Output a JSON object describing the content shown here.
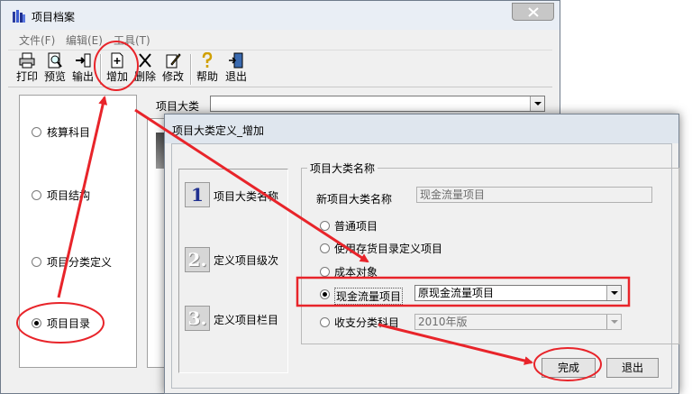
{
  "main_window": {
    "title": "项目档案",
    "menu": [
      "文件(F)",
      "编辑(E)",
      "工具(T)"
    ],
    "toolbar": {
      "print": "打印",
      "preview": "预览",
      "export": "输出",
      "add": "增加",
      "delete": "删除",
      "modify": "修改",
      "help": "帮助",
      "exit": "退出"
    },
    "left_options": [
      "核算科目",
      "项目结构",
      "项目分类定义",
      "项目目录"
    ],
    "selected_option": "项目目录",
    "category_label": "项目大类",
    "category_value": ""
  },
  "dialog": {
    "title": "项目大类定义_增加",
    "steps": [
      {
        "number": "1",
        "label": "项目大类名称"
      },
      {
        "number": "2.",
        "label": "定义项目级次"
      },
      {
        "number": "3.",
        "label": "定义项目栏目"
      }
    ],
    "group_title": "项目大类名称",
    "new_name_label": "新项目大类名称",
    "new_name_value": "现金流量项目",
    "options": [
      "普通项目",
      "使用存货目录定义项目",
      "成本对象",
      "现金流量项目",
      "收支分类科目"
    ],
    "selected_option": "现金流量项目",
    "cashflow_select_value": "原现金流量项目",
    "year_select_value": "2010年版",
    "finish_button": "完成",
    "exit_button": "退出"
  },
  "colors": {
    "annotation": "#e8242a",
    "window_bg": "#f0f0f0"
  }
}
